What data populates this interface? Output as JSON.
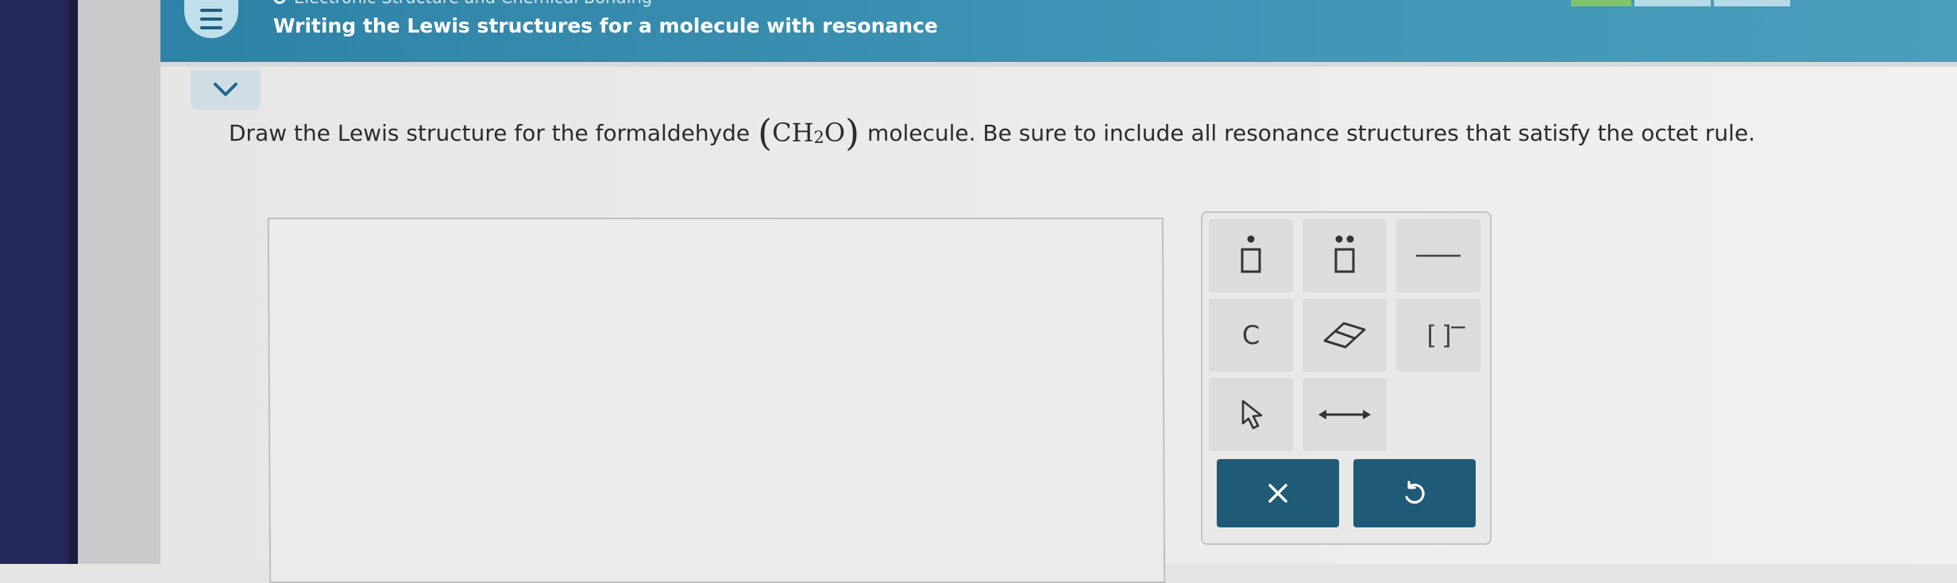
{
  "header": {
    "topic": "Electronic Structure and Chemical Bonding",
    "title": "Writing the Lewis structures for a molecule with resonance",
    "menu_icon": "hamburger-menu-icon",
    "collapse_icon": "chevron-down-icon"
  },
  "question": {
    "prefix": "Draw the Lewis structure for the formaldehyde",
    "formula_main": "CH",
    "formula_sub": "2",
    "formula_end": "O",
    "suffix": "molecule. Be sure to include all resonance structures that satisfy the octet rule."
  },
  "palette": {
    "tools": [
      {
        "name": "single-electron-tool",
        "icon": "dot-box-icon"
      },
      {
        "name": "lone-pair-tool",
        "icon": "two-dots-box-icon"
      },
      {
        "name": "bond-tool",
        "icon": "line-icon"
      },
      {
        "name": "atom-tool",
        "label": "C"
      },
      {
        "name": "eraser-tool",
        "icon": "eraser-icon"
      },
      {
        "name": "bracket-charge-tool",
        "label": "[ ]",
        "charge": "−"
      },
      {
        "name": "select-tool",
        "icon": "pointer-icon"
      },
      {
        "name": "resonance-arrow-tool",
        "icon": "double-arrow-icon"
      }
    ],
    "actions": [
      {
        "name": "clear-button",
        "icon": "x-icon"
      },
      {
        "name": "undo-button",
        "icon": "undo-icon"
      }
    ]
  },
  "colors": {
    "header": "#2d82a6",
    "action_button": "#1f5a77",
    "tool_bg": "#dcdcdc"
  }
}
